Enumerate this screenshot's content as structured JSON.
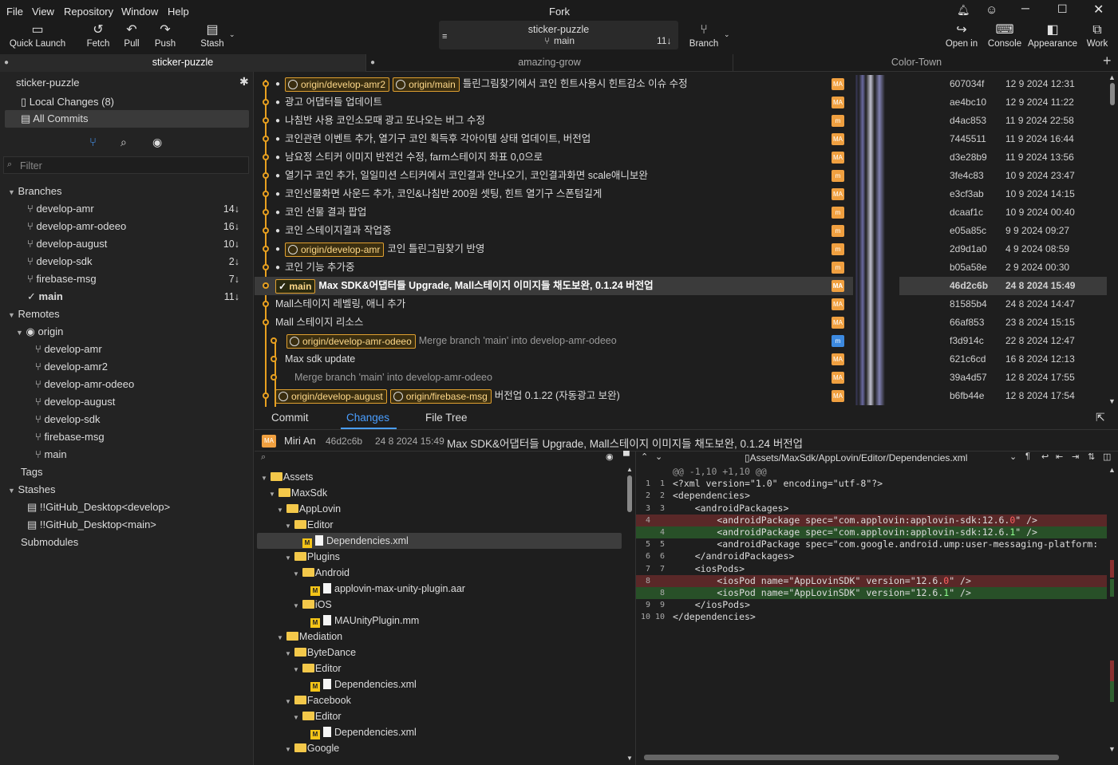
{
  "app": {
    "title": "Fork"
  },
  "menu": [
    "File",
    "View",
    "Repository",
    "Window",
    "Help"
  ],
  "toolbar": {
    "quick_launch": "Quick Launch",
    "fetch": "Fetch",
    "pull": "Pull",
    "push": "Push",
    "stash": "Stash",
    "branch": "Branch",
    "open_in": "Open in",
    "console": "Console",
    "appearance": "Appearance",
    "work": "Work"
  },
  "repo": {
    "name": "sticker-puzzle",
    "branch": "main",
    "count": "11↓"
  },
  "tabs": [
    "sticker-puzzle",
    "amazing-grow",
    "Color-Town"
  ],
  "sidebar": {
    "repo_name": "sticker-puzzle",
    "local_changes": "Local Changes (8)",
    "all_commits": "All Commits",
    "filter_placeholder": "Filter",
    "branches_label": "Branches",
    "branches": [
      {
        "name": "develop-amr",
        "count": "14↓"
      },
      {
        "name": "develop-amr-odeeo",
        "count": "16↓"
      },
      {
        "name": "develop-august",
        "count": "10↓"
      },
      {
        "name": "develop-sdk",
        "count": "2↓"
      },
      {
        "name": "firebase-msg",
        "count": "7↓"
      },
      {
        "name": "main",
        "count": "11↓"
      }
    ],
    "remotes_label": "Remotes",
    "origin": "origin",
    "remote_branches": [
      "develop-amr",
      "develop-amr2",
      "develop-amr-odeeo",
      "develop-august",
      "develop-sdk",
      "firebase-msg",
      "main"
    ],
    "tags_label": "Tags",
    "stashes_label": "Stashes",
    "stashes": [
      "!!GitHub_Desktop<develop>",
      "!!GitHub_Desktop<main>"
    ],
    "submodules_label": "Submodules"
  },
  "commits": [
    {
      "tags": [
        "origin/develop-amr2",
        "origin/main"
      ],
      "msg": "틀린그림찾기에서 코인 힌트사용시 힌트감소 이슈 수정",
      "av": "MA",
      "sha": "607034f",
      "date": "12 9 2024 12:31"
    },
    {
      "tags": [],
      "msg": "광고 어댑터들 업데이트",
      "av": "MA",
      "sha": "ae4bc10",
      "date": "12 9 2024 11:22"
    },
    {
      "tags": [],
      "msg": "나침반 사용 코인소모때 광고 또나오는 버그 수정",
      "av": "m",
      "sha": "d4ac853",
      "date": "11 9 2024 22:58"
    },
    {
      "tags": [],
      "msg": "코인관련 이벤트 추가, 열기구 코인 획득후 각아이템 상태 업데이트, 버전업",
      "av": "MA",
      "sha": "7445511",
      "date": "11 9 2024 16:44"
    },
    {
      "tags": [],
      "msg": "남요정 스티커 이미지 반전건 수정, farm스테이지 좌표 0,0으로",
      "av": "MA",
      "sha": "d3e28b9",
      "date": "11 9 2024 13:56"
    },
    {
      "tags": [],
      "msg": "열기구 코인 추가, 일일미션 스티커에서 코인결과 안나오기, 코인결과화면 scale애니보완",
      "av": "m",
      "sha": "3fe4c83",
      "date": "10 9 2024 23:47"
    },
    {
      "tags": [],
      "msg": "코인선물화면 사운드 추가, 코인&나침반 200원 셋팅, 힌트 열기구 스폰텀길게",
      "av": "MA",
      "sha": "e3cf3ab",
      "date": "10 9 2024 14:15"
    },
    {
      "tags": [],
      "msg": "코인 선물 결과 팝업",
      "av": "m",
      "sha": "dcaaf1c",
      "date": "10 9 2024 00:40"
    },
    {
      "tags": [],
      "msg": "코인 스테이지결과 작업중",
      "av": "m",
      "sha": "e05a85c",
      "date": "9 9 2024 09:27"
    },
    {
      "tags": [
        "origin/develop-amr"
      ],
      "msg": "코인 틀린그림찾기 반영",
      "av": "m",
      "sha": "2d9d1a0",
      "date": "4 9 2024 08:59"
    },
    {
      "tags": [],
      "msg": "코인 기능 추가중",
      "av": "m",
      "sha": "b05a58e",
      "date": "2 9 2024 00:30"
    },
    {
      "tags": [
        "main"
      ],
      "msg": "Max SDK&어댑터들 Upgrade, Mall스테이지 이미지들 채도보완, 0.1.24 버전업",
      "av": "MA",
      "sha": "46d2c6b",
      "date": "24 8 2024 15:49",
      "selected": true
    },
    {
      "tags": [],
      "msg": "Mall스테이지 레벨링, 애니 추가",
      "av": "MA",
      "sha": "81585b4",
      "date": "24 8 2024 14:47"
    },
    {
      "tags": [],
      "msg": "Mall 스테이지 리소스",
      "av": "MA",
      "sha": "66af853",
      "date": "23 8 2024 15:15"
    },
    {
      "tags": [
        "origin/develop-amr-odeeo"
      ],
      "msg": "Merge branch 'main' into develop-amr-odeeo",
      "av": "m",
      "sha": "f3d914c",
      "date": "22 8 2024 12:47",
      "merge": true
    },
    {
      "tags": [],
      "msg": "Max sdk update",
      "av": "MA",
      "sha": "621c6cd",
      "date": "16 8 2024 12:13"
    },
    {
      "tags": [],
      "msg": "Merge branch 'main' into develop-amr-odeeo",
      "av": "MA",
      "sha": "39a4d57",
      "date": "12 8 2024 17:55",
      "merge": true
    },
    {
      "tags": [
        "origin/develop-august",
        "origin/firebase-msg"
      ],
      "msg": "버전업 0.1.22 (자동광고 보완)",
      "av": "MA",
      "sha": "b6fb44e",
      "date": "12 8 2024 17:54"
    }
  ],
  "detail_tabs": [
    "Commit",
    "Changes",
    "File Tree"
  ],
  "commit_info": {
    "avatar": "MA",
    "author": "Miri An",
    "sha": "46d2c6b",
    "date": "24 8 2024 15:49",
    "message": "Max SDK&어댑터들 Upgrade, Mall스테이지 이미지들 채도보완, 0.1.24 버전업"
  },
  "diff_path": "Assets/MaxSdk/AppLovin/Editor/Dependencies.xml",
  "files": [
    {
      "name": "Assets",
      "type": "folder",
      "depth": 0
    },
    {
      "name": "MaxSdk",
      "type": "folder",
      "depth": 1
    },
    {
      "name": "AppLovin",
      "type": "folder",
      "depth": 2
    },
    {
      "name": "Editor",
      "type": "folder",
      "depth": 3
    },
    {
      "name": "Dependencies.xml",
      "type": "file",
      "depth": 4,
      "selected": true
    },
    {
      "name": "Plugins",
      "type": "folder",
      "depth": 3
    },
    {
      "name": "Android",
      "type": "folder",
      "depth": 4
    },
    {
      "name": "applovin-max-unity-plugin.aar",
      "type": "file",
      "depth": 5
    },
    {
      "name": "iOS",
      "type": "folder",
      "depth": 4
    },
    {
      "name": "MAUnityPlugin.mm",
      "type": "file",
      "depth": 5
    },
    {
      "name": "Mediation",
      "type": "folder",
      "depth": 2
    },
    {
      "name": "ByteDance",
      "type": "folder",
      "depth": 3
    },
    {
      "name": "Editor",
      "type": "folder",
      "depth": 4
    },
    {
      "name": "Dependencies.xml",
      "type": "file",
      "depth": 5
    },
    {
      "name": "Facebook",
      "type": "folder",
      "depth": 3
    },
    {
      "name": "Editor",
      "type": "folder",
      "depth": 4
    },
    {
      "name": "Dependencies.xml",
      "type": "file",
      "depth": 5
    },
    {
      "name": "Google",
      "type": "folder",
      "depth": 3
    }
  ],
  "diff": [
    {
      "o": "",
      "n": "",
      "t": "",
      "text": "@@ -1,10 +1,10 @@"
    },
    {
      "o": "1",
      "n": "1",
      "t": "",
      "text": "<?xml version=\"1.0\" encoding=\"utf-8\"?>"
    },
    {
      "o": "2",
      "n": "2",
      "t": "",
      "text": "<dependencies>"
    },
    {
      "o": "3",
      "n": "3",
      "t": "",
      "text": "    <androidPackages>"
    },
    {
      "o": "4",
      "n": "",
      "t": "del",
      "text": "        <androidPackage spec=\"com.applovin:applovin-sdk:12.6.0\" />"
    },
    {
      "o": "",
      "n": "4",
      "t": "add",
      "text": "        <androidPackage spec=\"com.applovin:applovin-sdk:12.6.1\" />"
    },
    {
      "o": "5",
      "n": "5",
      "t": "",
      "text": "        <androidPackage spec=\"com.google.android.ump:user-messaging-platform:"
    },
    {
      "o": "6",
      "n": "6",
      "t": "",
      "text": "    </androidPackages>"
    },
    {
      "o": "7",
      "n": "7",
      "t": "",
      "text": "    <iosPods>"
    },
    {
      "o": "8",
      "n": "",
      "t": "del",
      "text": "        <iosPod name=\"AppLovinSDK\" version=\"12.6.0\" />"
    },
    {
      "o": "",
      "n": "8",
      "t": "add",
      "text": "        <iosPod name=\"AppLovinSDK\" version=\"12.6.1\" />"
    },
    {
      "o": "9",
      "n": "9",
      "t": "",
      "text": "    </iosPods>"
    },
    {
      "o": "10",
      "n": "10",
      "t": "",
      "text": "</dependencies>"
    }
  ]
}
